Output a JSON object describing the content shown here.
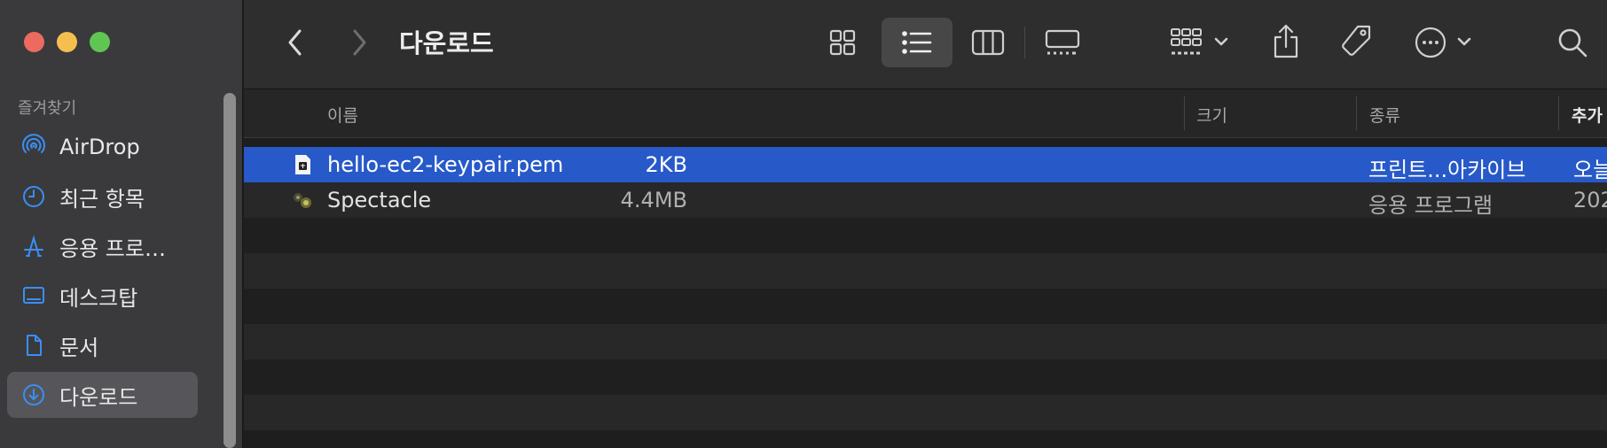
{
  "window": {
    "title": "다운로드"
  },
  "sidebar": {
    "section_label": "즐겨찾기",
    "items": [
      {
        "label": "AirDrop",
        "icon": "airdrop-icon",
        "active": false
      },
      {
        "label": "최근 항목",
        "icon": "clock-icon",
        "active": false
      },
      {
        "label": "응용 프로…",
        "icon": "applications-icon",
        "active": false
      },
      {
        "label": "데스크탑",
        "icon": "desktop-icon",
        "active": false
      },
      {
        "label": "문서",
        "icon": "document-icon",
        "active": false
      },
      {
        "label": "다운로드",
        "icon": "download-icon",
        "active": true
      }
    ]
  },
  "toolbar": {
    "back_icon": "chevron-left-icon",
    "forward_icon": "chevron-right-icon",
    "views": [
      "icon-view",
      "list-view",
      "column-view",
      "gallery-view"
    ],
    "active_view": "list-view"
  },
  "columns": {
    "name": "이름",
    "size": "크기",
    "kind": "종류",
    "added": "추가"
  },
  "files": [
    {
      "name": "hello-ec2-keypair.pem",
      "size": "2KB",
      "kind": "프린트...아카이브",
      "added": "오늘",
      "selected": true,
      "icon": "pem-file-icon"
    },
    {
      "name": "Spectacle",
      "size": "4.4MB",
      "kind": "응용 프로그램",
      "added": "202",
      "selected": false,
      "icon": "app-icon"
    }
  ],
  "colors": {
    "selection": "#2759c9",
    "accent": "#3a8ff5",
    "close": "#ed6a5e",
    "minimize": "#f5bf4f",
    "zoom": "#61c554"
  }
}
